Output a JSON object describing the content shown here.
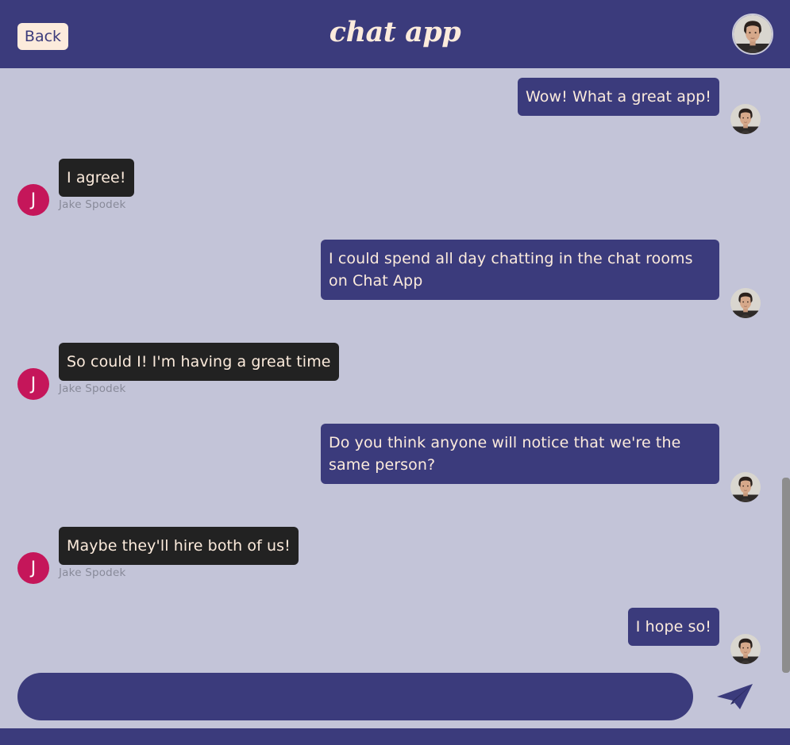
{
  "header": {
    "back_label": "Back",
    "title": "chat app"
  },
  "messages": [
    {
      "sender": "me",
      "text": "Wow! What a great app!"
    },
    {
      "sender": "them",
      "text": "I agree!",
      "name": "Jake Spodek",
      "initial": "J"
    },
    {
      "sender": "me",
      "text": "I could spend all day chatting in the chat rooms on Chat App"
    },
    {
      "sender": "them",
      "text": "So could I! I'm having a great time",
      "name": "Jake Spodek",
      "initial": "J"
    },
    {
      "sender": "me",
      "text": "Do you think anyone will notice that we're the same person?"
    },
    {
      "sender": "them",
      "text": "Maybe they'll hire both of us!",
      "name": "Jake Spodek",
      "initial": "J"
    },
    {
      "sender": "me",
      "text": "I hope so!"
    }
  ],
  "composer": {
    "value": "",
    "placeholder": ""
  },
  "colors": {
    "primary": "#3b3b7c",
    "background": "#c3c4d8",
    "accent_text": "#fcebdc",
    "other_bubble": "#222222",
    "letter_avatar": "#c5165a"
  },
  "icons": {
    "send": "paper-plane-icon",
    "profile": "profile-photo"
  }
}
